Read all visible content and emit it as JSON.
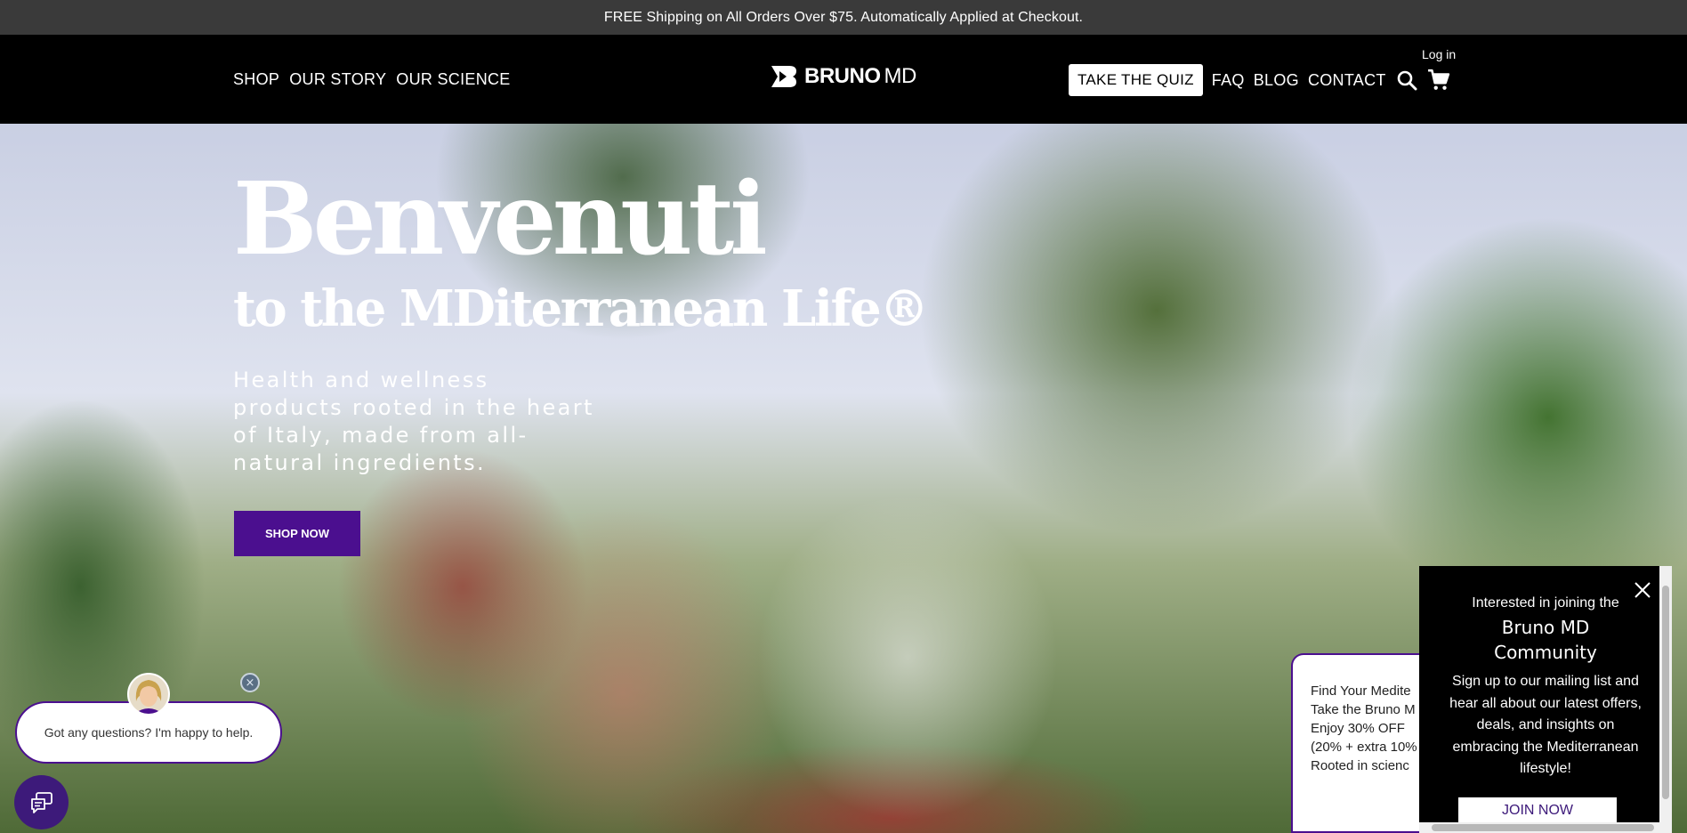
{
  "announcement": "FREE Shipping on All Orders Over $75. Automatically Applied at Checkout.",
  "header": {
    "nav_left": [
      "SHOP",
      "OUR STORY",
      "OUR SCIENCE"
    ],
    "logo": {
      "bold": "BRUNO",
      "thin": "MD"
    },
    "login": "Log in",
    "quiz_button": "TAKE THE QUIZ",
    "nav_right": [
      "FAQ",
      "BLOG",
      "CONTACT"
    ],
    "icons": [
      "search-icon",
      "cart-icon"
    ]
  },
  "hero": {
    "title": "Benvenuti",
    "subtitle": "to the MDiterranean Life®",
    "body": "Health and wellness products rooted in the heart of Italy, made from all-natural ingredients.",
    "cta": "SHOP NOW"
  },
  "chat": {
    "message": "Got any questions? I'm happy to help.",
    "close": "×"
  },
  "quiz_popup": {
    "lines": [
      "Find Your Medite",
      "Take the Bruno M",
      "Enjoy 30% OFF",
      "(20% + extra 10%",
      "Rooted in scienc"
    ]
  },
  "signup": {
    "lead": "Interested in joining the",
    "brand_line1": "Bruno MD",
    "brand_line2": "Community",
    "body": "Sign up to our mailing list and hear all about our latest offers, deals, and insights on embracing the Mediterranean lifestyle!",
    "button": "JOIN NOW"
  },
  "colors": {
    "brand_purple": "#4b0f8f",
    "announcement_bg": "#3a3a3a",
    "header_bg": "#000000"
  }
}
